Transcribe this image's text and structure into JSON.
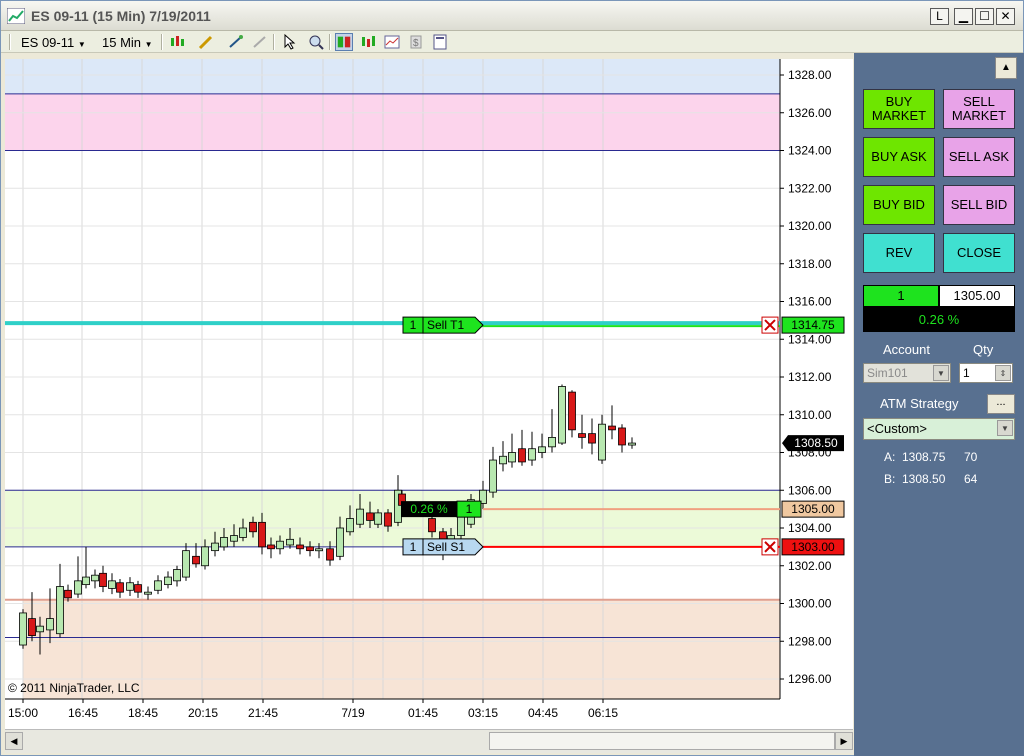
{
  "window": {
    "title": "ES 09-11 (15 Min)  7/19/2011",
    "buttons": {
      "link": "L",
      "minimize": "▁",
      "maximize": "☐",
      "close": "✕"
    }
  },
  "toolbar": {
    "instrument": "ES 09-11",
    "interval": "15 Min"
  },
  "colors": {
    "buy_button": "#6ee600",
    "sell_button": "#e8a3e8",
    "rev_button": "#40e0d0",
    "target_line": "#2fd0c8",
    "stop_line": "#ff0000",
    "entry_line": "#f0a080",
    "up_candle": "#b8e8b0",
    "down_candle": "#d81818",
    "panel_bg": "#587090"
  },
  "chart": {
    "copyright": "© 2011 NinjaTrader, LLC",
    "price_labels": [
      "1328.00",
      "1326.00",
      "1324.00",
      "1322.00",
      "1320.00",
      "1318.00",
      "1316.00",
      "1314.00",
      "1312.00",
      "1310.00",
      "1308.00",
      "1306.00",
      "1304.00",
      "1302.00",
      "1300.00",
      "1298.00",
      "1296.00"
    ],
    "time_labels": [
      "15:00",
      "16:45",
      "18:45",
      "20:15",
      "21:45",
      "7/19",
      "01:45",
      "03:15",
      "04:45",
      "06:15"
    ],
    "last_price": "1308.50",
    "target_price": "1314.75",
    "entry_price": "1305.00",
    "stop_price": "1303.00",
    "target_order": {
      "qty": "1",
      "label": "Sell T1"
    },
    "stop_order": {
      "qty": "1",
      "label": "Sell S1"
    },
    "position": {
      "pnl": "0.26 %",
      "qty": "1"
    }
  },
  "panel": {
    "buttons": {
      "buy_market": "BUY MARKET",
      "sell_market": "SELL MARKET",
      "buy_ask": "BUY ASK",
      "sell_ask": "SELL ASK",
      "buy_bid": "BUY BID",
      "sell_bid": "SELL BID",
      "rev": "REV",
      "close": "CLOSE"
    },
    "position_qty": "1",
    "position_price": "1305.00",
    "position_pnl": "0.26 %",
    "account_label": "Account",
    "qty_label": "Qty",
    "account_value": "Sim101",
    "qty_value": "1",
    "atm_label": "ATM Strategy",
    "atm_more": "...",
    "atm_value": "<Custom>",
    "ask_label": "A:",
    "ask_price": "1308.75",
    "ask_size": "70",
    "bid_label": "B:",
    "bid_price": "1308.50",
    "bid_size": "64"
  }
}
